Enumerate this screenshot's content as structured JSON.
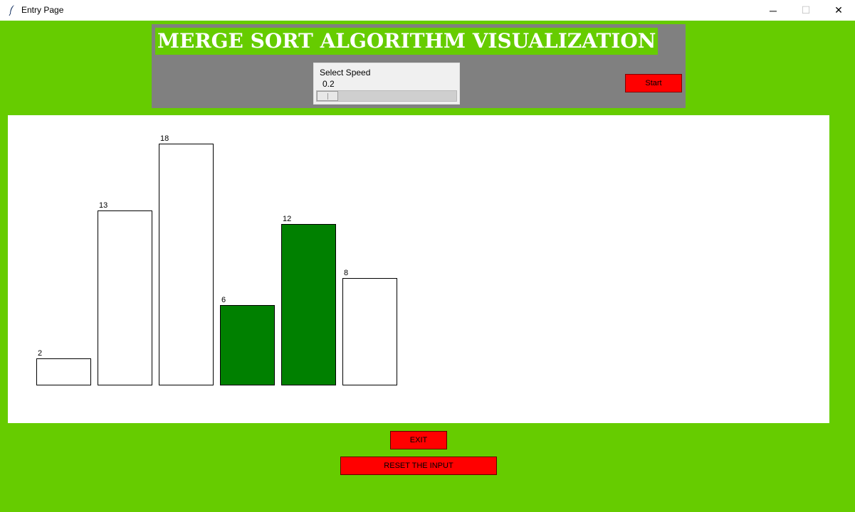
{
  "window": {
    "title": "Entry Page",
    "minimize_glyph": "─",
    "maximize_glyph": "☐",
    "close_glyph": "✕"
  },
  "header": {
    "title": "MERGE SORT ALGORITHM VISUALIZATION",
    "speed": {
      "label": "Select Speed",
      "value": "0.2",
      "min": 0.2,
      "max": 2.0
    },
    "start_label": "Start"
  },
  "chart_data": {
    "type": "bar",
    "title": "",
    "xlabel": "",
    "ylabel": "",
    "values": [
      2,
      13,
      18,
      6,
      12,
      8
    ],
    "labels": [
      "2",
      "13",
      "18",
      "6",
      "12",
      "8"
    ],
    "bar_colors": [
      "#ffffff",
      "#ffffff",
      "#ffffff",
      "#008000",
      "#008000",
      "#ffffff"
    ],
    "highlight_color": "#008000"
  },
  "controls": {
    "exit_label": "EXIT",
    "reset_label": "RESET THE INPUT"
  },
  "colors": {
    "background": "#66cc00",
    "header_frame": "#808080",
    "button": "#ff0000",
    "highlight": "#008000"
  }
}
